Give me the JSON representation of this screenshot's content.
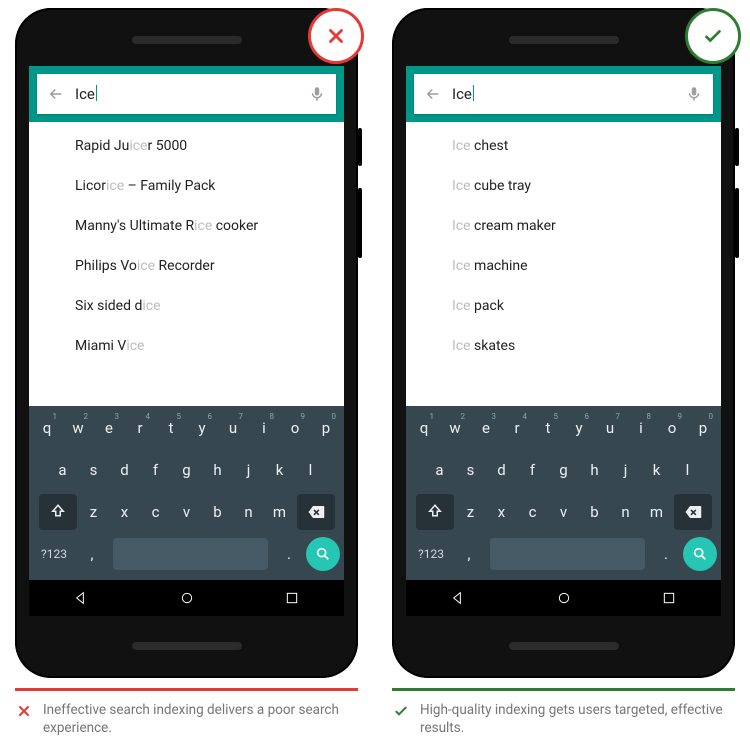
{
  "left": {
    "badge": "X",
    "search_query": "Ice",
    "suggestions": [
      {
        "pre": "Rapid Ju",
        "hi": "ice",
        "post": "r 5000"
      },
      {
        "pre": "Licor",
        "hi": "ice",
        "post": " – Family Pack"
      },
      {
        "pre": "Manny's Ultimate R",
        "hi": "ice",
        "post": " cooker"
      },
      {
        "pre": "Philips Vo",
        "hi": "ice",
        "post": " Recorder"
      },
      {
        "pre": "Six sided d",
        "hi": "ice",
        "post": ""
      },
      {
        "pre": "Miami V",
        "hi": "ice",
        "post": ""
      }
    ],
    "caption": "Ineffective search indexing delivers a poor search experience."
  },
  "right": {
    "badge": "✓",
    "search_query": "Ice",
    "suggestions": [
      {
        "pre": "",
        "hi": "Ice",
        "post": " chest"
      },
      {
        "pre": "",
        "hi": "Ice",
        "post": " cube tray"
      },
      {
        "pre": "",
        "hi": "Ice",
        "post": " cream maker"
      },
      {
        "pre": "",
        "hi": "Ice",
        "post": " machine"
      },
      {
        "pre": "",
        "hi": "Ice",
        "post": " pack"
      },
      {
        "pre": "",
        "hi": "Ice",
        "post": " skates"
      }
    ],
    "caption": "High-quality indexing gets users targeted, effective results."
  },
  "keyboard": {
    "row1": [
      "q",
      "w",
      "e",
      "r",
      "t",
      "y",
      "u",
      "i",
      "o",
      "p"
    ],
    "row1_nums": [
      "1",
      "2",
      "3",
      "4",
      "5",
      "6",
      "7",
      "8",
      "9",
      "0"
    ],
    "row2": [
      "a",
      "s",
      "d",
      "f",
      "g",
      "h",
      "j",
      "k",
      "l"
    ],
    "row3": [
      "z",
      "x",
      "c",
      "v",
      "b",
      "n",
      "m"
    ],
    "sym": "?123",
    "comma": ",",
    "period": "."
  }
}
